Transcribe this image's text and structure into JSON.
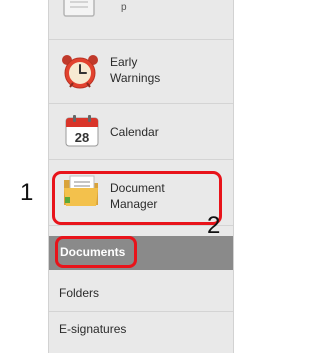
{
  "sidebar": {
    "items": [
      {
        "label": "",
        "icon": "clipboard-icon"
      },
      {
        "label_line1": "Early",
        "label_line2": "Warnings",
        "icon": "alarm-clock-icon"
      },
      {
        "label": "Calendar",
        "icon": "calendar-icon",
        "icon_text": "28"
      },
      {
        "label_line1": "Document",
        "label_line2": "Manager",
        "icon": "folder-icon"
      }
    ],
    "subitems": [
      {
        "label": "Documents",
        "selected": true
      },
      {
        "label": "Folders"
      },
      {
        "label": "E-signatures"
      }
    ]
  },
  "annotations": {
    "marker_1": "1",
    "marker_2": "2",
    "highlight_color": "#e8131a"
  }
}
